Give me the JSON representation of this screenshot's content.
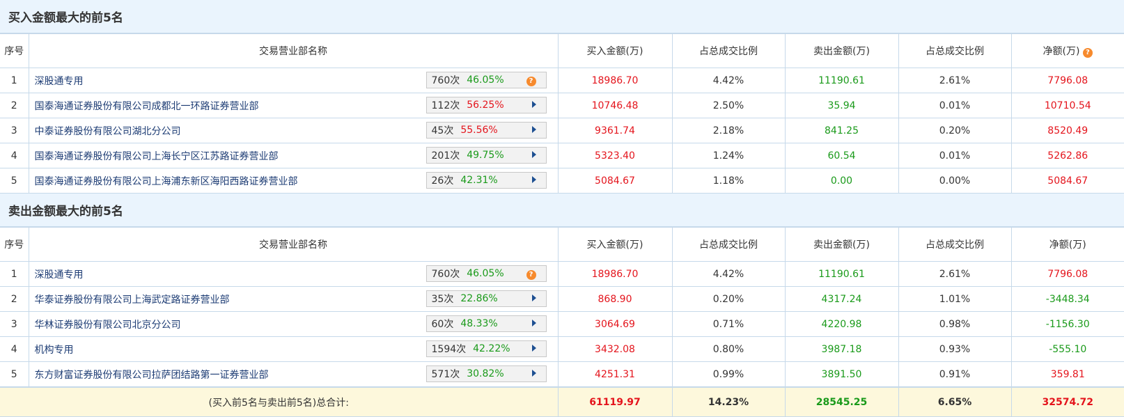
{
  "columns": [
    "序号",
    "交易营业部名称",
    "买入金额(万)",
    "占总成交比例",
    "卖出金额(万)",
    "占总成交比例",
    "净额(万)"
  ],
  "buy_section": {
    "title": "买入金额最大的前5名",
    "rows": [
      {
        "rank": "1",
        "name": "深股通专用",
        "count": "760次",
        "ratio": "46.05%",
        "icon": "help",
        "buy": "18986.70",
        "buy_pct": "4.42%",
        "sell": "11190.61",
        "sell_pct": "2.61%",
        "net": "7796.08"
      },
      {
        "rank": "2",
        "name": "国泰海通证券股份有限公司成都北一环路证券营业部",
        "count": "112次",
        "ratio": "56.25%",
        "ratio_color": "red",
        "icon": "arrow",
        "buy": "10746.48",
        "buy_pct": "2.50%",
        "sell": "35.94",
        "sell_pct": "0.01%",
        "net": "10710.54"
      },
      {
        "rank": "3",
        "name": "中泰证券股份有限公司湖北分公司",
        "count": "45次",
        "ratio": "55.56%",
        "ratio_color": "red",
        "icon": "arrow",
        "buy": "9361.74",
        "buy_pct": "2.18%",
        "sell": "841.25",
        "sell_pct": "0.20%",
        "net": "8520.49"
      },
      {
        "rank": "4",
        "name": "国泰海通证券股份有限公司上海长宁区江苏路证券营业部",
        "count": "201次",
        "ratio": "49.75%",
        "icon": "arrow",
        "buy": "5323.40",
        "buy_pct": "1.24%",
        "sell": "60.54",
        "sell_pct": "0.01%",
        "net": "5262.86"
      },
      {
        "rank": "5",
        "name": "国泰海通证券股份有限公司上海浦东新区海阳西路证券营业部",
        "count": "26次",
        "ratio": "42.31%",
        "icon": "arrow",
        "buy": "5084.67",
        "buy_pct": "1.18%",
        "sell": "0.00",
        "sell_pct": "0.00%",
        "net": "5084.67"
      }
    ]
  },
  "sell_section": {
    "title": "卖出金额最大的前5名",
    "rows": [
      {
        "rank": "1",
        "name": "深股通专用",
        "count": "760次",
        "ratio": "46.05%",
        "icon": "help",
        "buy": "18986.70",
        "buy_pct": "4.42%",
        "sell": "11190.61",
        "sell_pct": "2.61%",
        "net": "7796.08"
      },
      {
        "rank": "2",
        "name": "华泰证券股份有限公司上海武定路证券营业部",
        "count": "35次",
        "ratio": "22.86%",
        "icon": "arrow",
        "buy": "868.90",
        "buy_pct": "0.20%",
        "sell": "4317.24",
        "sell_pct": "1.01%",
        "net": "-3448.34"
      },
      {
        "rank": "3",
        "name": "华林证券股份有限公司北京分公司",
        "count": "60次",
        "ratio": "48.33%",
        "icon": "arrow",
        "buy": "3064.69",
        "buy_pct": "0.71%",
        "sell": "4220.98",
        "sell_pct": "0.98%",
        "net": "-1156.30"
      },
      {
        "rank": "4",
        "name": "机构专用",
        "count": "1594次",
        "ratio": "42.22%",
        "icon": "arrow",
        "buy": "3432.08",
        "buy_pct": "0.80%",
        "sell": "3987.18",
        "sell_pct": "0.93%",
        "net": "-555.10"
      },
      {
        "rank": "5",
        "name": "东方财富证券股份有限公司拉萨团结路第一证券营业部",
        "count": "571次",
        "ratio": "30.82%",
        "icon": "arrow",
        "buy": "4251.31",
        "buy_pct": "0.99%",
        "sell": "3891.50",
        "sell_pct": "0.91%",
        "net": "359.81"
      }
    ]
  },
  "total": {
    "label": "(买入前5名与卖出前5名)总合计:",
    "buy": "61119.97",
    "buy_pct": "14.23%",
    "sell": "28545.25",
    "sell_pct": "6.65%",
    "net": "32574.72"
  },
  "help_glyph": "?"
}
